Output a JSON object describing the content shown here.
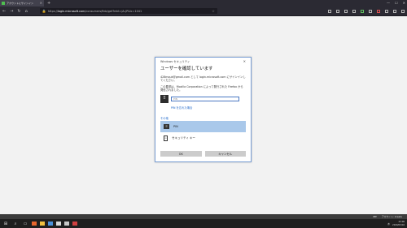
{
  "browser": {
    "tab_title": "アカウントにサインイン",
    "new_tab": "+",
    "url_prefix": "https://",
    "url_host": "login.microsoft.com",
    "url_rest": "/consumers/fido/get?mkt=JA-JP&lc=1041",
    "back": "←",
    "forward": "→",
    "reload": "↻",
    "home": "⌂"
  },
  "dialog": {
    "header": "Windows セキュリティ",
    "close": "✕",
    "title": "ユーザーを確認しています",
    "line1": "428mouk@gmail.com として login.microsoft.com にサインインしてください。",
    "line2": "この要求は、Mozilla Corporation によって発行された Firefox から発信されました。",
    "pin_placeholder": "PIN",
    "forgot": "PIN を忘れた場合",
    "options_label": "その他",
    "options": [
      {
        "label": "PIN",
        "icon": "keypad-icon"
      },
      {
        "label": "セキュリティ キー",
        "icon": "security-key-icon"
      }
    ],
    "ok": "OK",
    "cancel": "キャンセル"
  },
  "edge_bar": {
    "item1": "IME",
    "item2": "アカウント: Create"
  },
  "taskbar": {
    "tray_text": "あ",
    "time": "23:06",
    "date": "2020/03/16"
  }
}
